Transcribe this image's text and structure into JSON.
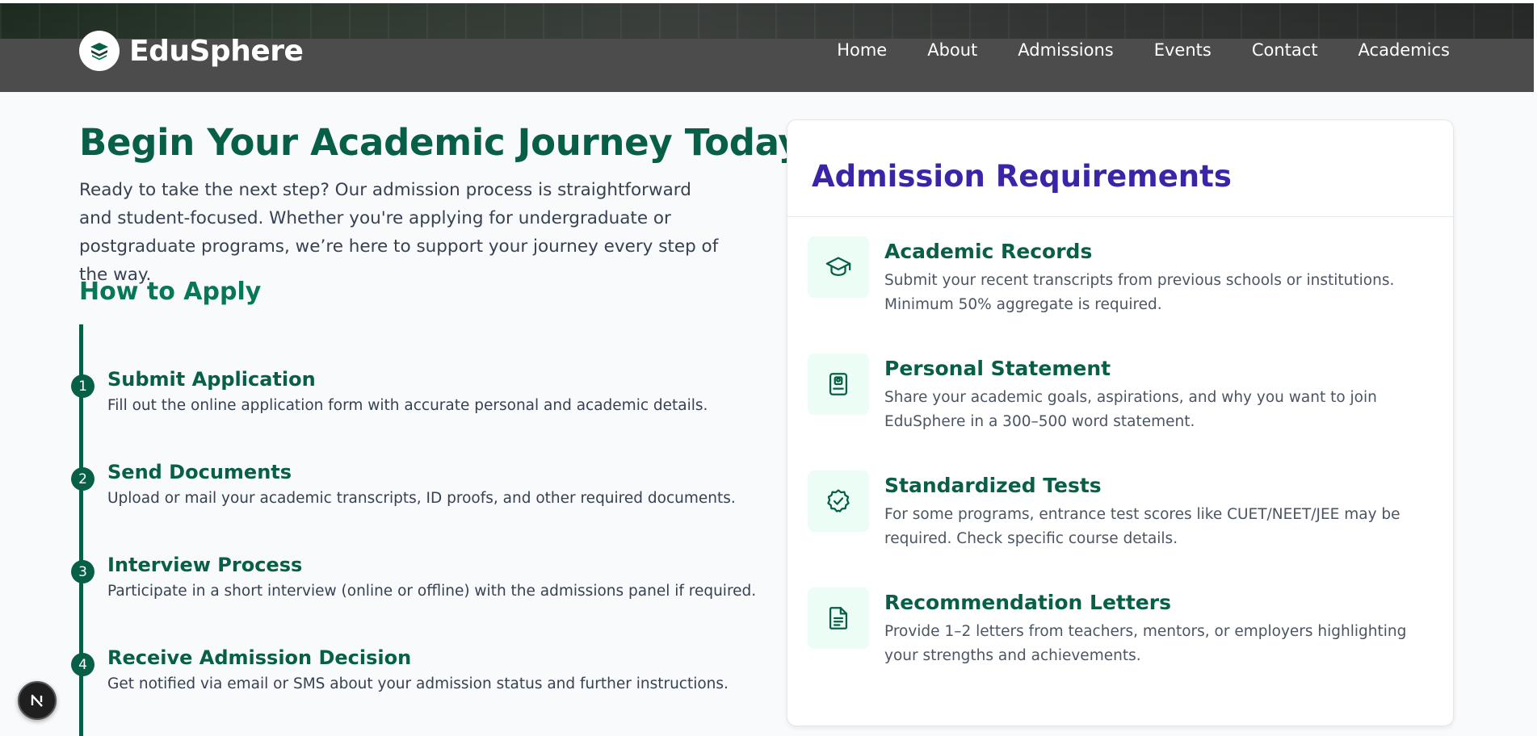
{
  "header": {
    "brand": "EduSphere",
    "nav": [
      "Home",
      "About",
      "Admissions",
      "Events",
      "Contact",
      "Academics"
    ]
  },
  "hero": {
    "title": "Begin Your Academic Journey Today",
    "intro": "Ready to take the next step? Our admission process is straightforward and student-focused. Whether you're applying for undergraduate or postgraduate programs, we’re here to support your journey every step of the way."
  },
  "how_to_apply": {
    "title": "How to Apply",
    "steps": [
      {
        "num": "1",
        "title": "Submit Application",
        "desc": "Fill out the online application form with accurate personal and academic details."
      },
      {
        "num": "2",
        "title": "Send Documents",
        "desc": "Upload or mail your academic transcripts, ID proofs, and other required documents."
      },
      {
        "num": "3",
        "title": "Interview Process",
        "desc": "Participate in a short interview (online or offline) with the admissions panel if required."
      },
      {
        "num": "4",
        "title": "Receive Admission Decision",
        "desc": "Get notified via email or SMS about your admission status and further instructions."
      }
    ]
  },
  "requirements": {
    "title": "Admission Requirements",
    "items": [
      {
        "icon": "graduation-cap-icon",
        "title": "Academic Records",
        "desc": "Submit your recent transcripts from previous schools or institutions. Minimum 50% aggregate is required."
      },
      {
        "icon": "id-card-icon",
        "title": "Personal Statement",
        "desc": "Share your academic goals, aspirations, and why you want to join EduSphere in a 300–500 word statement."
      },
      {
        "icon": "badge-check-icon",
        "title": "Standardized Tests",
        "desc": "For some programs, entrance test scores like CUET/NEET/JEE may be required. Check specific course details."
      },
      {
        "icon": "document-text-icon",
        "title": "Recommendation Letters",
        "desc": "Provide 1–2 letters from teachers, mentors, or employers highlighting your strengths and achievements."
      }
    ]
  },
  "floating_badge": {
    "label": "N"
  },
  "colors": {
    "primary_green": "#065f46",
    "accent_purple": "#3b24a8",
    "icon_bg": "#ecfdf5",
    "page_bg": "#f8fafc"
  }
}
